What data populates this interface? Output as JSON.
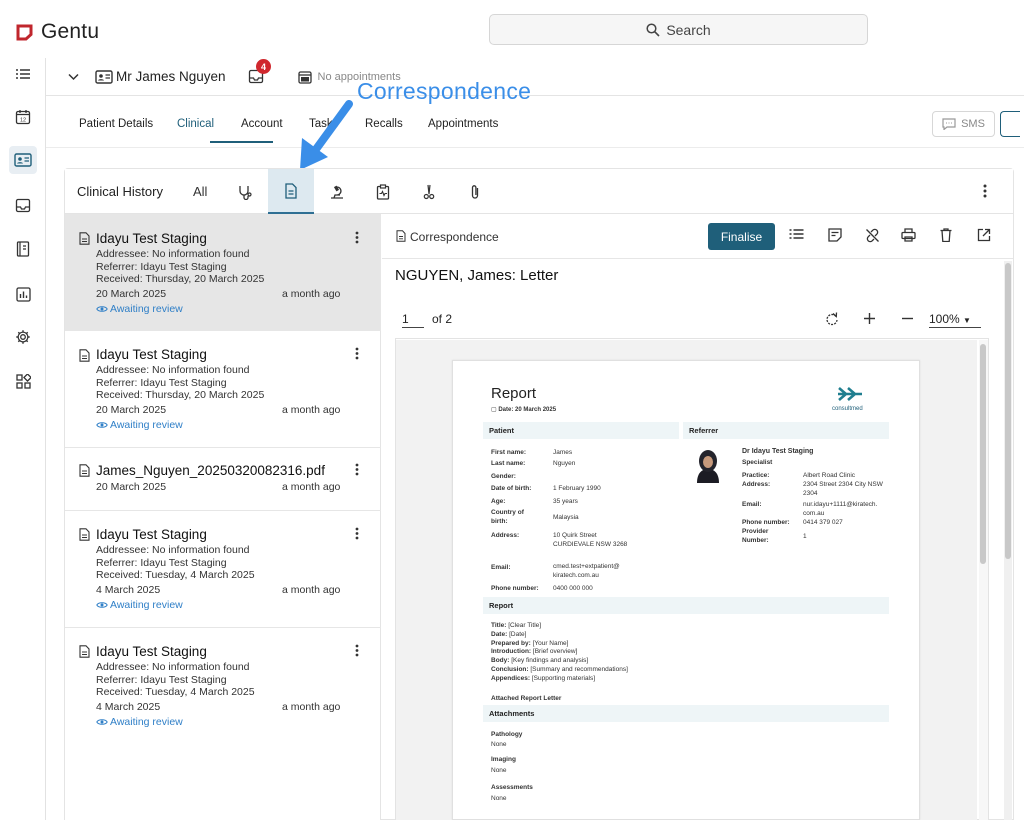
{
  "app": {
    "name": "Gentu"
  },
  "search": {
    "label": "Search"
  },
  "patient": {
    "name": "Mr James Nguyen",
    "inbox_count": "4",
    "appointments": "No appointments"
  },
  "callout": "Correspondence",
  "tabs": [
    "Patient Details",
    "Clinical",
    "Account",
    "Tasks",
    "Recalls",
    "Appointments"
  ],
  "sms_label": "SMS",
  "clinical_history": {
    "title": "Clinical History",
    "all_label": "All"
  },
  "items": [
    {
      "title": "Idayu Test Staging",
      "addressee": "Addressee: No information found",
      "referrer": "Referrer: Idayu Test Staging",
      "received": "Received: Thursday, 20 March 2025",
      "date": "20 March 2025",
      "ago": "a month ago",
      "status": "Awaiting review"
    },
    {
      "title": "Idayu Test Staging",
      "addressee": "Addressee: No information found",
      "referrer": "Referrer: Idayu Test Staging",
      "received": "Received: Thursday, 20 March 2025",
      "date": "20 March 2025",
      "ago": "a month ago",
      "status": "Awaiting review"
    },
    {
      "title": "James_Nguyen_20250320082316.pdf",
      "date": "20 March 2025",
      "ago": "a month ago"
    },
    {
      "title": "Idayu Test Staging",
      "addressee": "Addressee: No information found",
      "referrer": "Referrer: Idayu Test Staging",
      "received": "Received: Tuesday, 4 March 2025",
      "date": "4 March 2025",
      "ago": "a month ago",
      "status": "Awaiting review"
    },
    {
      "title": "Idayu Test Staging",
      "addressee": "Addressee: No information found",
      "referrer": "Referrer: Idayu Test Staging",
      "received": "Received: Tuesday, 4 March 2025",
      "date": "4 March 2025",
      "ago": "a month ago",
      "status": "Awaiting review"
    }
  ],
  "viewer": {
    "type_label": "Correspondence",
    "finalise_label": "Finalise",
    "letter_title": "NGUYEN, James: Letter",
    "page_current": "1",
    "page_total": "of 2",
    "zoom": "100%"
  },
  "report": {
    "heading": "Report",
    "date_line": "Date: 20 March 2025",
    "brand": "consultmed",
    "patient_section": "Patient",
    "referrer_section": "Referrer",
    "patient_fields": [
      {
        "label": "First name:",
        "value": "James"
      },
      {
        "label": "Last name:",
        "value": "Nguyen"
      },
      {
        "label": "Gender:",
        "value": ""
      },
      {
        "label": "Date of birth:",
        "value": "1 February 1990"
      },
      {
        "label": "Age:",
        "value": "35 years"
      },
      {
        "label": "Country of birth:",
        "value": "Malaysia"
      },
      {
        "label": "Address:",
        "value": "10 Quirk Street CURDIEVALE NSW 3268"
      },
      {
        "label": "Email:",
        "value": "cmed.test+extpatient@ kiratech.com.au"
      },
      {
        "label": "Phone number:",
        "value": "0400 000 000"
      }
    ],
    "referrer_name": "Dr Idayu Test Staging",
    "referrer_role": "Specialist",
    "referrer_fields": [
      {
        "label": "Practice:",
        "value": "Albert Road Clinic"
      },
      {
        "label": "Address:",
        "value": "2304 Street 2304 City NSW 2304"
      },
      {
        "label": "Email:",
        "value": "nur.idayu+1111@kiratech. com.au"
      },
      {
        "label": "Phone number:",
        "value": "0414 379 027"
      },
      {
        "label": "Provider Number:",
        "value": "1"
      }
    ],
    "report_section": "Report",
    "report_lines": [
      {
        "label": "Title:",
        "value": "[Clear Title]"
      },
      {
        "label": "Date:",
        "value": "[Date]"
      },
      {
        "label": "Prepared by:",
        "value": "[Your Name]"
      },
      {
        "label": "Introduction:",
        "value": "[Brief overview]"
      },
      {
        "label": "Body:",
        "value": "[Key findings and analysis]"
      },
      {
        "label": "Conclusion:",
        "value": "[Summary and recommendations]"
      },
      {
        "label": "Appendices:",
        "value": "[Supporting materials]"
      }
    ],
    "attached_label": "Attached Report Letter",
    "attachments_section": "Attachments",
    "attachments": [
      {
        "label": "Pathology",
        "value": "None"
      },
      {
        "label": "Imaging",
        "value": "None"
      },
      {
        "label": "Assessments",
        "value": "None"
      }
    ]
  },
  "colors": {
    "accent": "#1f5f7a",
    "link": "#2f7fc7",
    "callout": "#3a8ee8",
    "badge": "#d0282e",
    "logo": "#c0262d"
  }
}
